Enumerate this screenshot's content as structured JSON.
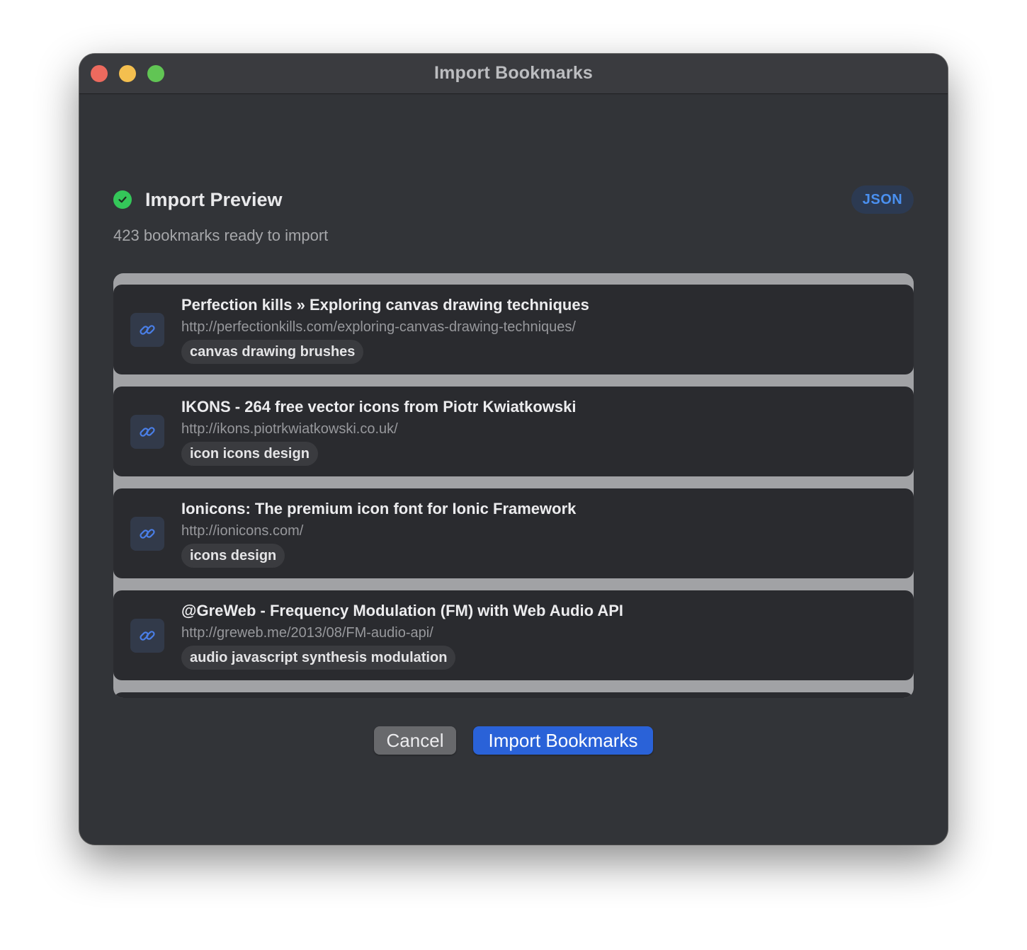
{
  "window": {
    "title": "Import Bookmarks"
  },
  "preview": {
    "title": "Import Preview",
    "format_badge": "JSON",
    "summary": "423 bookmarks ready to import"
  },
  "bookmarks": [
    {
      "title": "Perfection kills » Exploring canvas drawing techniques",
      "url": "http://perfectionkills.com/exploring-canvas-drawing-techniques/",
      "tags": "canvas drawing brushes"
    },
    {
      "title": "IKONS - 264 free vector icons from Piotr Kwiatkowski",
      "url": "http://ikons.piotrkwiatkowski.co.uk/",
      "tags": "icon icons design"
    },
    {
      "title": "Ionicons: The premium icon font for Ionic Framework",
      "url": "http://ionicons.com/",
      "tags": "icons design"
    },
    {
      "title": "@GreWeb - Frequency Modulation (FM) with Web Audio API",
      "url": "http://greweb.me/2013/08/FM-audio-api/",
      "tags": "audio javascript synthesis modulation"
    }
  ],
  "actions": {
    "cancel_label": "Cancel",
    "import_label": "Import Bookmarks"
  },
  "colors": {
    "accent": "#2a62d8",
    "success": "#34c759",
    "window_bg": "#323438"
  },
  "icons": {
    "header_status": "checkmark-circle-icon",
    "bookmark": "link-icon"
  }
}
